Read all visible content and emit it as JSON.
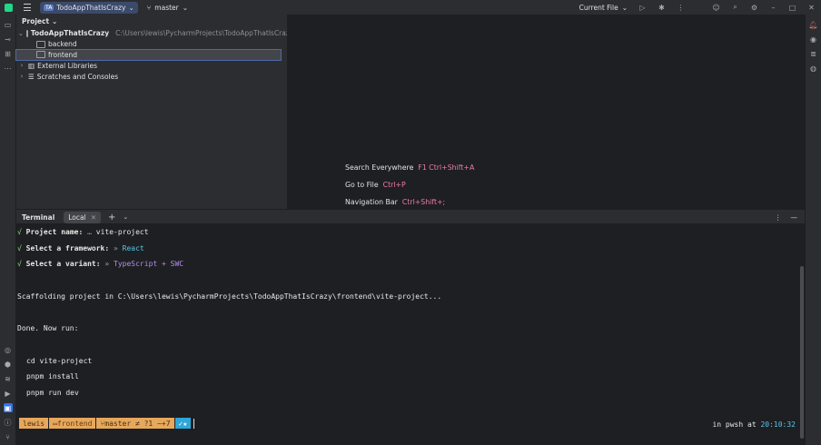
{
  "topbar": {
    "project_initials": "TA",
    "project_name": "TodoAppThatIsCrazy",
    "branch": "master",
    "run_config": "Current File"
  },
  "project_panel": {
    "title": "Project",
    "root_name": "TodoAppThatIsCrazy",
    "root_path": "C:\\Users\\lewis\\PycharmProjects\\TodoAppThatIsCrazy",
    "children": [
      "backend",
      "frontend"
    ],
    "selected": "frontend",
    "external_libraries": "External Libraries",
    "scratches": "Scratches and Consoles"
  },
  "editor_hints": [
    {
      "label": "Search Everywhere",
      "shortcut": "F1 Ctrl+Shift+A"
    },
    {
      "label": "Go to File",
      "shortcut": "Ctrl+P"
    },
    {
      "label": "Navigation Bar",
      "shortcut": "Ctrl+Shift+;"
    }
  ],
  "terminal": {
    "title": "Terminal",
    "tab_label": "Local",
    "lines": {
      "project_name_q": "Project name:",
      "project_name_v": "vite-project",
      "framework_q": "Select a framework:",
      "framework_v": "React",
      "variant_q": "Select a variant:",
      "variant_v": "TypeScript + SWC",
      "scaffolding": "Scaffolding project in C:\\Users\\lewis\\PycharmProjects\\TodoAppThatIsCrazy\\frontend\\vite-project...",
      "done": "Done. Now run:",
      "cmd1": "cd vite-project",
      "cmd2": "pnpm install",
      "cmd3": "pnpm run dev"
    },
    "prompt": {
      "user": "lewis",
      "dir": "frontend",
      "git": "master ≠ ?1 ~+7",
      "shell_text": "in pwsh at",
      "time": "20:10:32"
    }
  }
}
